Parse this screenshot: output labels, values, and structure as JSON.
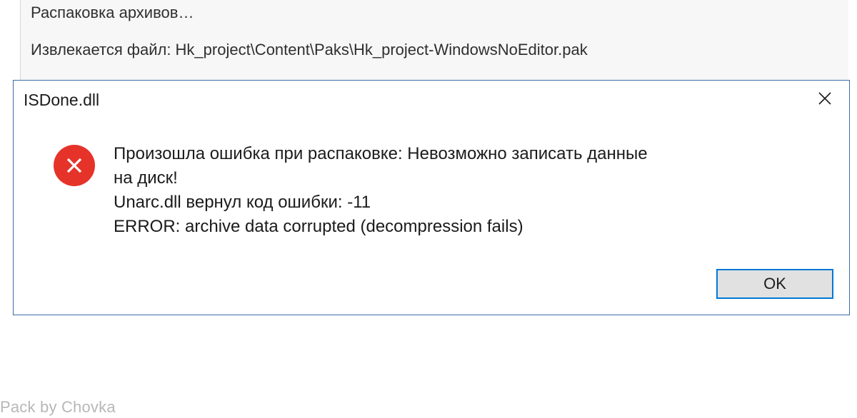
{
  "background": {
    "line1": "Распаковка архивов…",
    "line2": "Извлекается файл: Hk_project\\Content\\Paks\\Hk_project-WindowsNoEditor.pak"
  },
  "dialog": {
    "title": "ISDone.dll",
    "message": {
      "line1": "Произошла ошибка при распаковке: Невозможно записать данные",
      "line2": "на диск!",
      "line3": "Unarc.dll вернул код ошибки: -11",
      "line4": "ERROR: archive data corrupted (decompression fails)"
    },
    "ok_label": "OK"
  },
  "watermark": "Pack by Chovka"
}
